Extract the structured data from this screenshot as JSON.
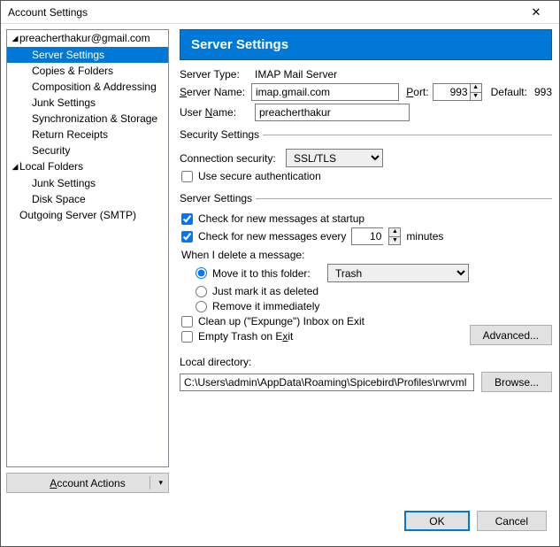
{
  "window": {
    "title": "Account Settings",
    "close": "✕"
  },
  "sidebar": {
    "account": "preacherthakur@gmail.com",
    "items": [
      "Server Settings",
      "Copies & Folders",
      "Composition & Addressing",
      "Junk Settings",
      "Synchronization & Storage",
      "Return Receipts",
      "Security"
    ],
    "local_label": "Local Folders",
    "local_items": [
      "Junk Settings",
      "Disk Space"
    ],
    "outgoing": "Outgoing Server (SMTP)",
    "actions_prefix": "A",
    "actions_rest": "ccount Actions"
  },
  "main": {
    "header": "Server Settings",
    "server_type_label": "Server Type:",
    "server_type_value": "IMAP Mail Server",
    "server_name_lbl_pre": "S",
    "server_name_lbl_rest": "erver Name:",
    "server_name_value": "imap.gmail.com",
    "port_lbl_pre": "P",
    "port_lbl_rest": "ort:",
    "port_value": "993",
    "default_label": "Default:",
    "default_value": "993",
    "user_lbl": "User ",
    "user_lbl_u": "N",
    "user_lbl_rest": "ame:",
    "user_value": "preacherthakur",
    "sec_legend": "Security Settings",
    "conn_sec_label": "Connection security:",
    "conn_sec_value": "SSL/TLS",
    "secure_auth": "Use secure authentication",
    "srv_legend": "Server Settings",
    "check_startup": "Check for new messages at startup",
    "check_every_pre": "Check for new messages every",
    "check_every_val": "10",
    "check_every_post": "minutes",
    "delete_label": "When I delete a message:",
    "delete_opt1": "Move it to this folder:",
    "delete_folder": "Trash",
    "delete_opt2": "Just mark it as deleted",
    "delete_opt3": "Remove it immediately",
    "cleanup": "Clean up (\"Expunge\") Inbox on Exit",
    "empty_trash_pre": "Empty Trash on E",
    "empty_trash_u": "x",
    "empty_trash_rest": "it",
    "advanced": "Advanced...",
    "local_dir_label": "Local directory:",
    "local_dir_value": "C:\\Users\\admin\\AppData\\Roaming\\Spicebird\\Profiles\\rwrvml",
    "browse": "Browse..."
  },
  "footer": {
    "ok": "OK",
    "cancel": "Cancel"
  }
}
